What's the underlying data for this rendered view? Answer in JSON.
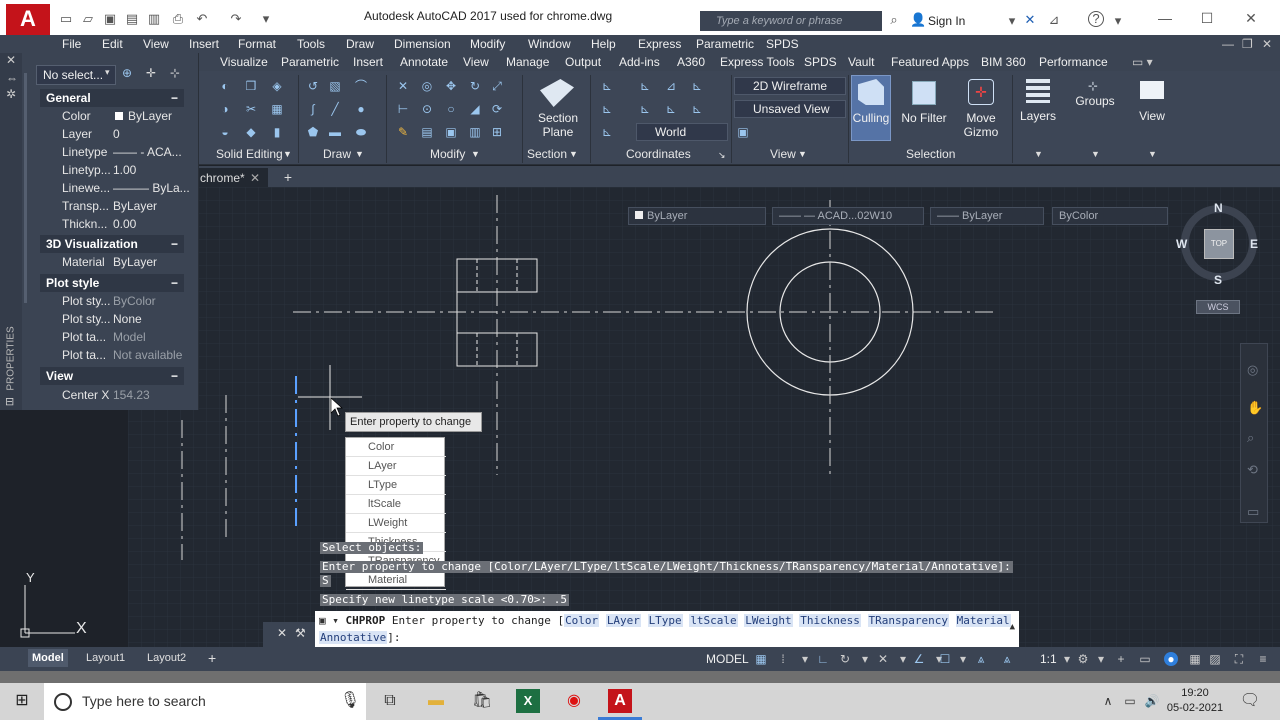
{
  "window": {
    "title": "Autodesk AutoCAD 2017     used for chrome.dwg",
    "search_placeholder": "Type a keyword or phrase",
    "sign_in": "Sign In"
  },
  "menu": [
    "File",
    "Edit",
    "View",
    "Insert",
    "Format",
    "Tools",
    "Draw",
    "Dimension",
    "Modify",
    "Window",
    "Help",
    "Express",
    "Parametric",
    "SPDS"
  ],
  "ribbon_tabs": [
    "Visualize",
    "Parametric",
    "Insert",
    "Annotate",
    "View",
    "Manage",
    "Output",
    "Add-ins",
    "A360",
    "Express Tools",
    "SPDS",
    "Vault",
    "Featured Apps",
    "BIM 360",
    "Performance"
  ],
  "ribbon": {
    "panels": {
      "solid_editing": "Solid Editing",
      "draw": "Draw",
      "modify": "Modify",
      "section": "Section",
      "coordinates": "Coordinates",
      "view": "View",
      "selection": "Selection"
    },
    "section_plane": "Section\nPlane",
    "visual_style": "2D Wireframe",
    "view_name": "Unsaved View",
    "ucs": "World",
    "culling": "Culling",
    "no_filter": "No Filter",
    "move_gizmo": "Move\nGizmo",
    "layers": "Layers",
    "groups": "Groups",
    "view_btn": "View"
  },
  "file_tab": "chrome*",
  "properties": {
    "selection": "No select...",
    "sidebar_label": "PROPERTIES",
    "sections": {
      "general": "General",
      "viz": "3D Visualization",
      "plot": "Plot style",
      "view": "View"
    },
    "general_rows": [
      {
        "label": "Color",
        "value": "ByLayer"
      },
      {
        "label": "Layer",
        "value": "0"
      },
      {
        "label": "Linetype",
        "value": "—— - ACA..."
      },
      {
        "label": "Linetyp...",
        "value": "1.00"
      },
      {
        "label": "Linewe...",
        "value": "——— ByLa..."
      },
      {
        "label": "Transp...",
        "value": "ByLayer"
      },
      {
        "label": "Thickn...",
        "value": "0.00"
      }
    ],
    "viz_rows": [
      {
        "label": "Material",
        "value": "ByLayer"
      }
    ],
    "plot_rows": [
      {
        "label": "Plot sty...",
        "value": "ByColor"
      },
      {
        "label": "Plot sty...",
        "value": "None"
      },
      {
        "label": "Plot ta...",
        "value": "Model"
      },
      {
        "label": "Plot ta...",
        "value": "Not available"
      }
    ],
    "view_rows": [
      {
        "label": "Center X",
        "value": "154.23"
      }
    ]
  },
  "prop_bar": {
    "layer": "ByLayer",
    "linetype": "—— — ACAD...02W10",
    "lineweight": "—— ByLayer",
    "color": "ByColor"
  },
  "viewcube": {
    "n": "N",
    "s": "S",
    "e": "E",
    "w": "W",
    "top": "TOP",
    "wcs": "WCS"
  },
  "ucs_axes": {
    "x": "X",
    "y": "Y"
  },
  "tooltip": "Enter property to change",
  "option_list": [
    "Color",
    "LAyer",
    "LType",
    "ltScale",
    "LWeight",
    "Thickness",
    "TRansparency",
    "Material"
  ],
  "history": {
    "line1": "Select objects:",
    "line2": "Enter property to change [Color/LAyer/LType/ltScale/LWeight/Thickness/TRansparency/Material/Annotative]:",
    "line3": "S",
    "line4": "Specify new linetype scale <0.70>: .5"
  },
  "command": {
    "name": "CHPROP",
    "prompt": "Enter property to change [",
    "options": [
      "Color",
      "LAyer",
      "LType",
      "ltScale",
      "LWeight",
      "Thickness",
      "TRansparency",
      "Material",
      "Annotative"
    ],
    "suffix": "]:"
  },
  "layout_tabs": [
    "Model",
    "Layout1",
    "Layout2"
  ],
  "status": {
    "model": "MODEL",
    "scale": "1:1"
  },
  "taskbar": {
    "search_placeholder": "Type here to search",
    "time": "19:20",
    "date": "05-02-2021"
  }
}
